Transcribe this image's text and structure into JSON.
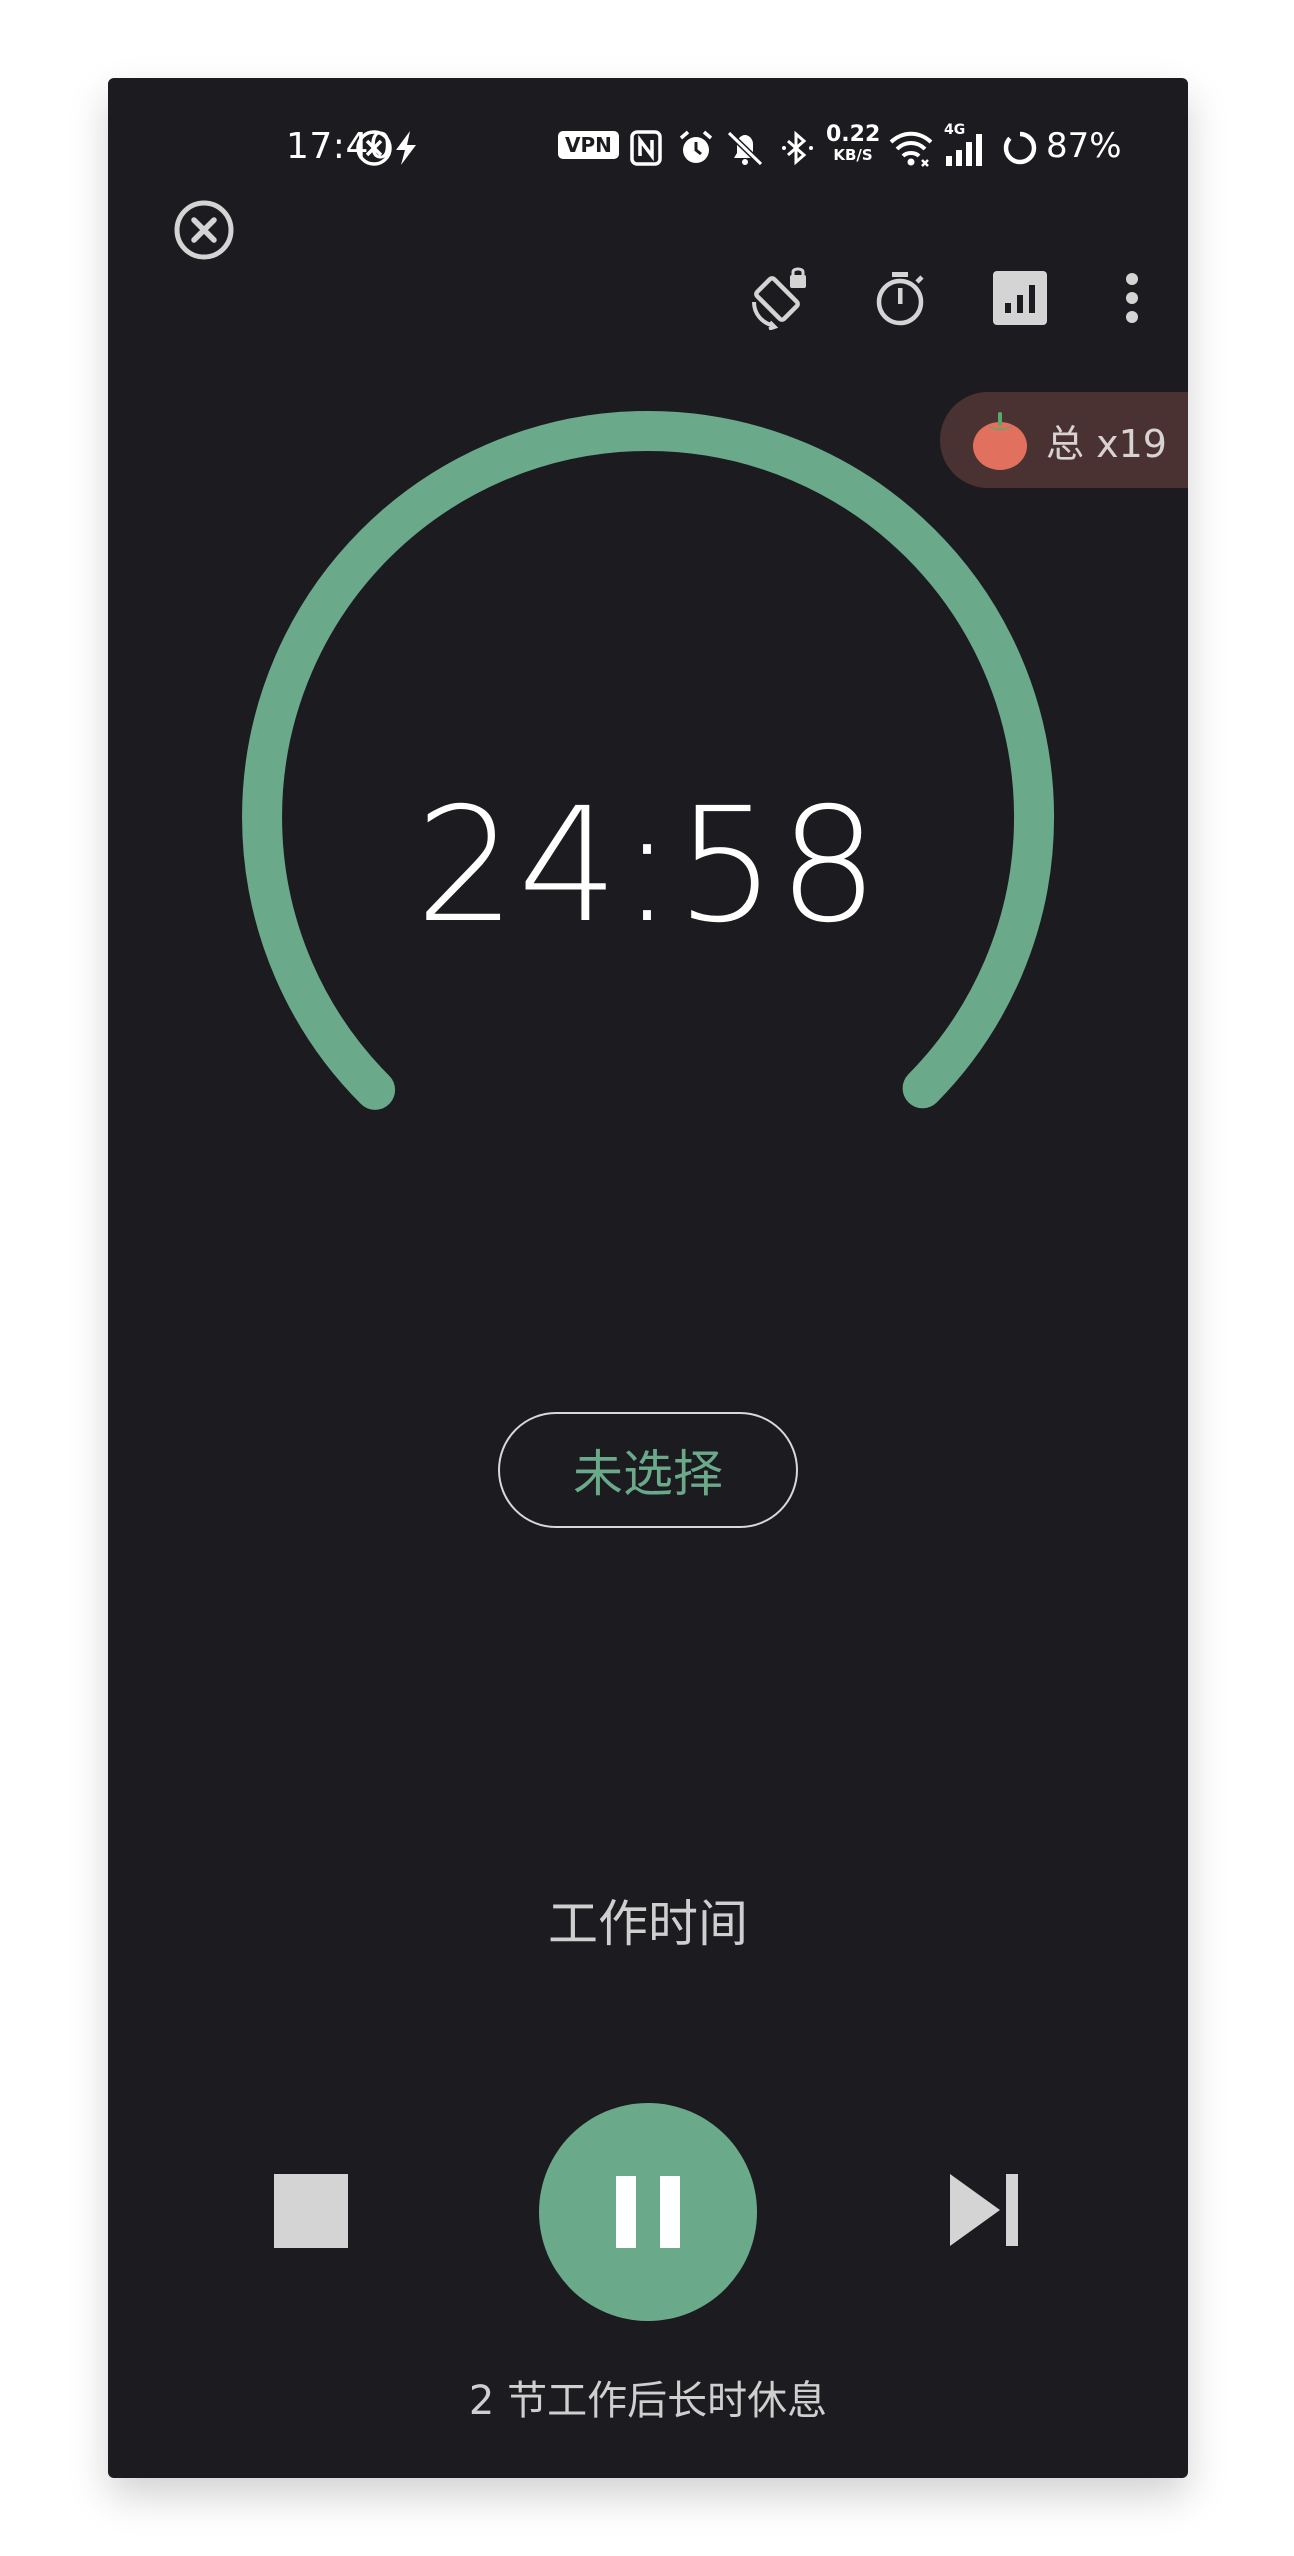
{
  "status_bar": {
    "time": "17:40",
    "vpn": "VPN",
    "net_speed_value": "0.22",
    "net_speed_unit": "KB/S",
    "network_type": "4G",
    "battery": "87%",
    "icons": [
      "overlay-icon",
      "flash-icon",
      "vpn-icon",
      "nfc-icon",
      "alarm-icon",
      "mute-icon",
      "bluetooth-icon",
      "wifi-icon",
      "signal-icon",
      "battery-icon"
    ]
  },
  "toolbar": {
    "icons": [
      "close-icon",
      "rotation-lock-icon",
      "timer-icon",
      "stats-icon",
      "more-vert-icon"
    ]
  },
  "pomodoro": {
    "count_label": "总 x19"
  },
  "timer": {
    "remaining": "24:58",
    "progress": 0.9987
  },
  "tag": {
    "label": "未选择"
  },
  "session": {
    "label": "工作时间"
  },
  "controls": {
    "icons": [
      "stop-icon",
      "pause-icon",
      "skip-next-icon"
    ]
  },
  "footer": {
    "text": "2 节工作后长时休息"
  },
  "colors": {
    "background": "#1c1c20",
    "accent": "#6aaa8a",
    "badge_bg": "#4a3233",
    "tomato": "#e2705e"
  }
}
